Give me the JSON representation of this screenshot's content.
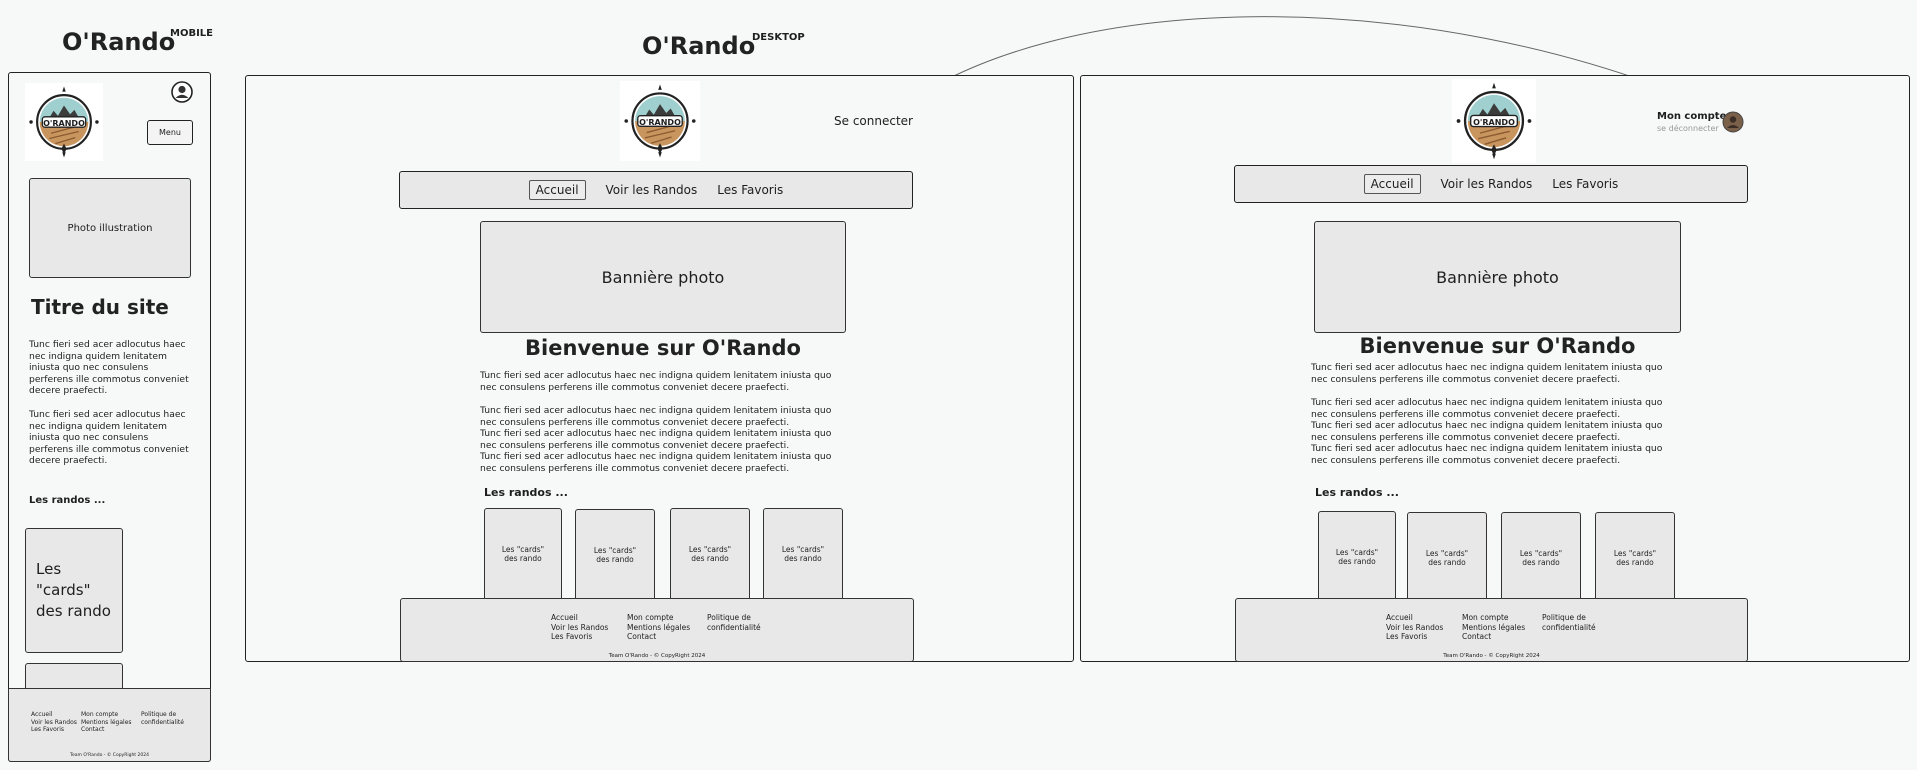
{
  "mobile": {
    "title": "O'Rando",
    "label": "MOBILE",
    "menu": "Menu",
    "photo": "Photo illustration",
    "site_title": "Titre du site",
    "paragraph1": "Tunc fieri sed acer adlocutus haec nec indigna quidem lenitatem iniusta quo nec consulens perferens ille commotus conveniet decere praefecti.",
    "paragraph2": "Tunc fieri sed acer adlocutus haec nec indigna quidem lenitatem iniusta quo nec consulens perferens ille commotus conveniet decere praefecti.",
    "randos_heading": "Les randos ...",
    "card_text": "Les \"cards\" des rando",
    "footer": {
      "col1": [
        "Accueil",
        "Voir les Randos",
        "Les Favoris"
      ],
      "col2": [
        "Mon compte",
        "Mentions légales",
        "Contact"
      ],
      "col3": [
        "Politique de",
        "confidentialité"
      ],
      "copyright": "Team O'Rando - © CopyRight 2024"
    }
  },
  "desktop": {
    "title": "O'Rando",
    "label": "DESKTOP",
    "login": "Se connecter",
    "account": "Mon compte",
    "logout": "se déconnecter",
    "nav": [
      "Accueil",
      "Voir les Randos",
      "Les Favoris"
    ],
    "banner": "Bannière photo",
    "welcome": "Bienvenue sur O'Rando",
    "p1": "Tunc fieri sed acer adlocutus haec nec indigna quidem lenitatem iniusta quo nec consulens perferens ille commotus conveniet decere praefecti.",
    "p2": "Tunc fieri sed acer adlocutus haec nec indigna quidem lenitatem iniusta quo nec consulens perferens ille commotus conveniet decere praefecti.",
    "p3": "Tunc fieri sed acer adlocutus haec nec indigna quidem lenitatem iniusta quo nec consulens perferens ille commotus conveniet decere praefecti.",
    "p4": "Tunc fieri sed acer adlocutus haec nec indigna quidem lenitatem iniusta quo nec consulens perferens ille commotus conveniet decere praefecti.",
    "randos_heading": "Les randos ...",
    "card_line1": "Les \"cards\"",
    "card_line2": "des rando",
    "footer": {
      "col1": [
        "Accueil",
        "Voir les Randos",
        "Les Favoris"
      ],
      "col2": [
        "Mon compte",
        "Mentions légales",
        "Contact"
      ],
      "col3": [
        "Politique de",
        "confidentialité"
      ],
      "copyright": "Team O'Rando - © CopyRight 2024"
    }
  },
  "logo": {
    "text": "O'RANDO",
    "compass": [
      "N",
      "E",
      "S",
      "O"
    ]
  },
  "colors": {
    "background": "#f7f8f8",
    "box": "#e8e8e8",
    "stroke": "#222222",
    "logo_sky": "#9fd0cf",
    "logo_ground": "#c9955f",
    "avatar": "#7a5f49"
  },
  "icons": [
    "user-account-icon",
    "avatar-icon",
    "compass-logo"
  ]
}
